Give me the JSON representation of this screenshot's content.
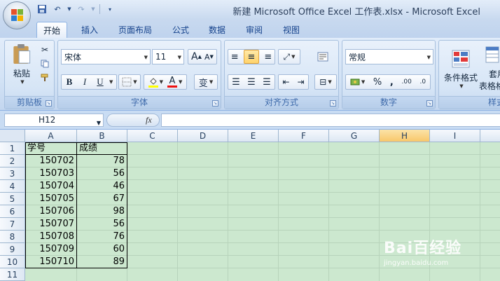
{
  "window": {
    "title": "新建 Microsoft Office Excel 工作表.xlsx - Microsoft Excel"
  },
  "tabs": [
    {
      "label": "开始",
      "active": true
    },
    {
      "label": "插入"
    },
    {
      "label": "页面布局"
    },
    {
      "label": "公式"
    },
    {
      "label": "数据"
    },
    {
      "label": "审阅"
    },
    {
      "label": "视图"
    }
  ],
  "ribbon": {
    "clipboard": {
      "label": "剪贴板",
      "paste": "粘贴"
    },
    "font": {
      "label": "字体",
      "font_name": "宋体",
      "font_size": "11",
      "bold": "B",
      "italic": "I",
      "underline": "U",
      "grow": "A",
      "shrink": "A",
      "font_color": "A",
      "phonetic": "变"
    },
    "alignment": {
      "label": "对齐方式"
    },
    "number": {
      "label": "数字",
      "format": "常规",
      "percent": "%",
      "comma": ",",
      "inc_decimal": ".00",
      "dec_decimal": ".0"
    },
    "styles": {
      "label": "样式",
      "cond_format": "条件格式",
      "table_format": "套用",
      "table_format2": "表格格"
    }
  },
  "formula_bar": {
    "name_box": "H12",
    "fx": "fx",
    "value": ""
  },
  "sheet": {
    "columns": [
      "A",
      "B",
      "C",
      "D",
      "E",
      "F",
      "G",
      "H",
      "I"
    ],
    "active_column": "H",
    "rows": [
      "1",
      "2",
      "3",
      "4",
      "5",
      "6",
      "7",
      "8",
      "9",
      "10",
      "11"
    ],
    "header": [
      "学号",
      "成绩"
    ],
    "data": [
      [
        "150702",
        "78"
      ],
      [
        "150703",
        "56"
      ],
      [
        "150704",
        "46"
      ],
      [
        "150705",
        "67"
      ],
      [
        "150706",
        "98"
      ],
      [
        "150707",
        "56"
      ],
      [
        "150708",
        "76"
      ],
      [
        "150709",
        "60"
      ],
      [
        "150710",
        "89"
      ]
    ]
  },
  "watermark": {
    "brand": "Bai百经验",
    "url": "jingyan.baidu.com"
  },
  "colors": {
    "cell_fill": "#cce8cf",
    "ribbon": "#d2e2f5",
    "active_header": "#f8c76a"
  }
}
